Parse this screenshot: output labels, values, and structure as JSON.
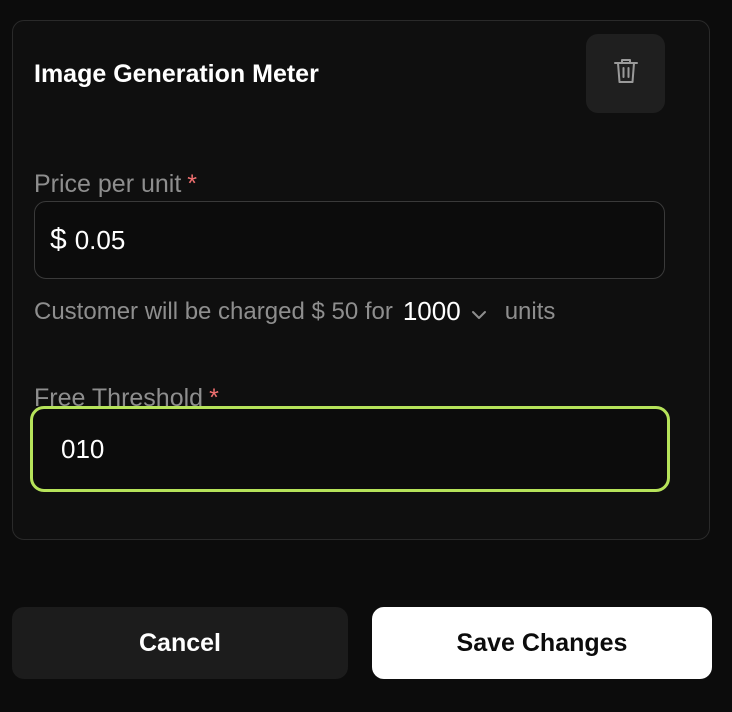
{
  "meter": {
    "title": "Image Generation Meter",
    "delete_icon": "trash-icon"
  },
  "price_field": {
    "label": "Price per unit",
    "required_mark": "*",
    "currency_symbol": "$",
    "value": "0.05"
  },
  "charge_summary": {
    "prefix": "Customer will be charged $ 50 for",
    "unit_quantity": "1000",
    "dropdown_icon": "chevron-down-icon",
    "suffix": "units"
  },
  "threshold_field": {
    "label": "Free Threshold",
    "required_mark": "*",
    "value": "010",
    "focus_color": "#b6e35a"
  },
  "actions": {
    "cancel_label": "Cancel",
    "save_label": "Save Changes"
  },
  "colors": {
    "background": "#0c0c0c",
    "required": "#f07070",
    "muted_text": "#8e8e8e"
  }
}
